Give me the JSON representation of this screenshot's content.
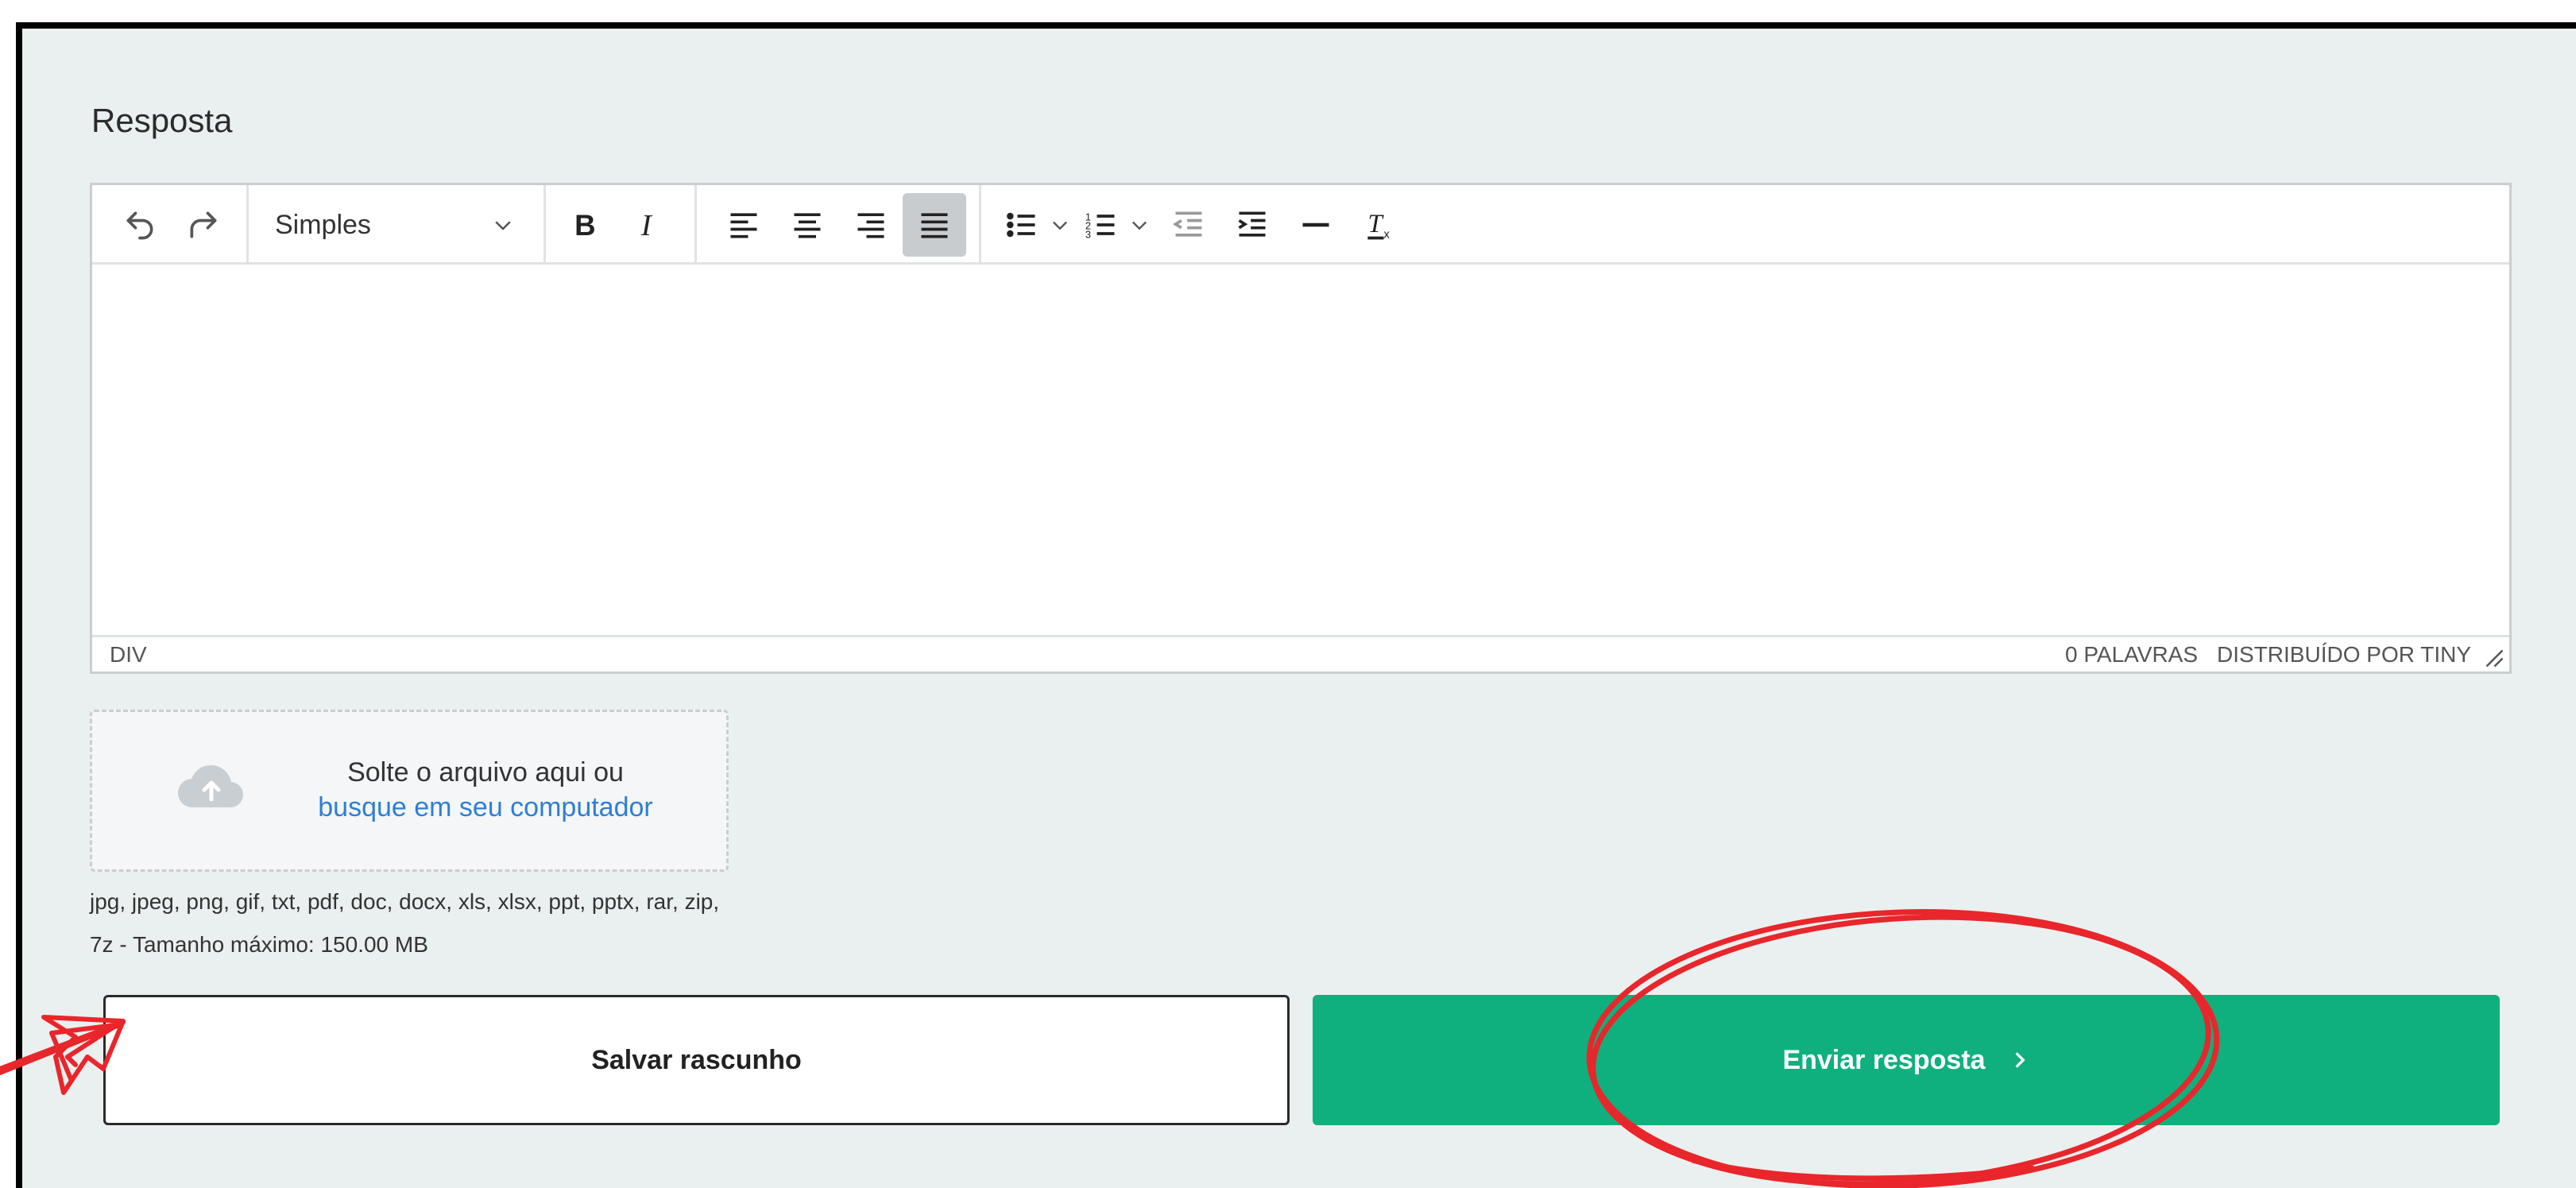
{
  "section": {
    "label": "Resposta"
  },
  "editor": {
    "format_value": "Simples",
    "status_path": "DIV",
    "word_count": "0 PALAVRAS",
    "powered_by": "DISTRIBUÍDO POR TINY",
    "content": ""
  },
  "upload": {
    "line1": "Solte o arquivo aqui ou",
    "link": "busque em seu computador",
    "types_line1": "jpg, jpeg, png, gif, txt, pdf, doc, docx, xls, xlsx, ppt, pptx, rar, zip,",
    "types_line2": "7z - Tamanho máximo: 150.00 MB"
  },
  "actions": {
    "draft_label": "Salvar rascunho",
    "send_label": "Enviar resposta",
    "send_icon": "chevron-right-icon"
  },
  "colors": {
    "panel_bg": "#eaf0ef",
    "send_button": "#0fb07d",
    "link": "#2f7fd4",
    "annotation": "#e8262b"
  }
}
